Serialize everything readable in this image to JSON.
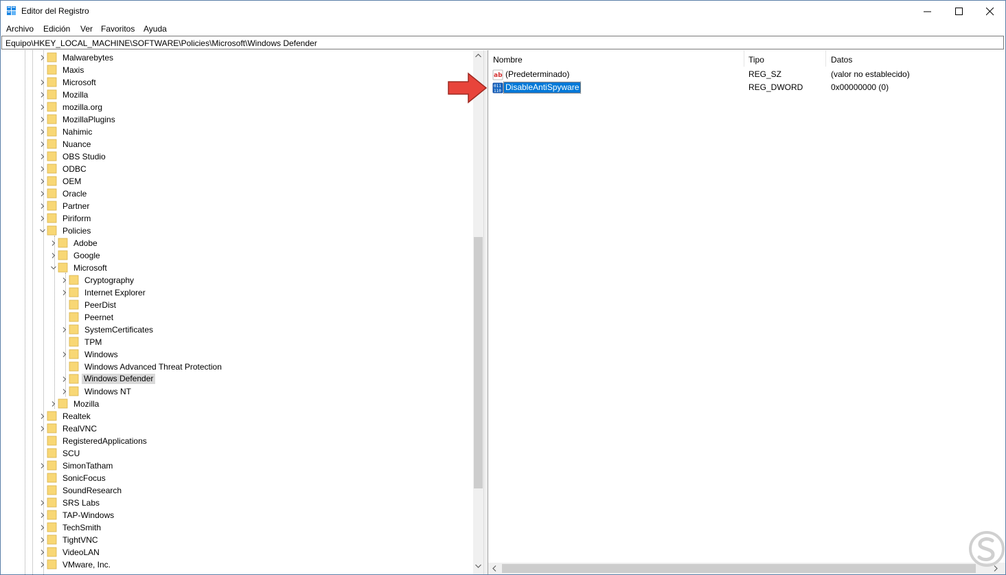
{
  "window": {
    "title": "Editor del Registro",
    "menu": [
      "Archivo",
      "Edición",
      "Ver",
      "Favoritos",
      "Ayuda"
    ],
    "address": "Equipo\\HKEY_LOCAL_MACHINE\\SOFTWARE\\Policies\\Microsoft\\Windows Defender"
  },
  "tree": {
    "items": [
      {
        "label": "Malwarebytes",
        "level": 0,
        "expander": "collapsed"
      },
      {
        "label": "Maxis",
        "level": 0,
        "expander": "none"
      },
      {
        "label": "Microsoft",
        "level": 0,
        "expander": "collapsed"
      },
      {
        "label": "Mozilla",
        "level": 0,
        "expander": "collapsed"
      },
      {
        "label": "mozilla.org",
        "level": 0,
        "expander": "collapsed"
      },
      {
        "label": "MozillaPlugins",
        "level": 0,
        "expander": "collapsed"
      },
      {
        "label": "Nahimic",
        "level": 0,
        "expander": "collapsed"
      },
      {
        "label": "Nuance",
        "level": 0,
        "expander": "collapsed"
      },
      {
        "label": "OBS Studio",
        "level": 0,
        "expander": "collapsed"
      },
      {
        "label": "ODBC",
        "level": 0,
        "expander": "collapsed"
      },
      {
        "label": "OEM",
        "level": 0,
        "expander": "collapsed"
      },
      {
        "label": "Oracle",
        "level": 0,
        "expander": "collapsed"
      },
      {
        "label": "Partner",
        "level": 0,
        "expander": "collapsed"
      },
      {
        "label": "Piriform",
        "level": 0,
        "expander": "collapsed"
      },
      {
        "label": "Policies",
        "level": 0,
        "expander": "expanded"
      },
      {
        "label": "Adobe",
        "level": 1,
        "expander": "collapsed"
      },
      {
        "label": "Google",
        "level": 1,
        "expander": "collapsed"
      },
      {
        "label": "Microsoft",
        "level": 1,
        "expander": "expanded"
      },
      {
        "label": "Cryptography",
        "level": 2,
        "expander": "collapsed"
      },
      {
        "label": "Internet Explorer",
        "level": 2,
        "expander": "collapsed"
      },
      {
        "label": "PeerDist",
        "level": 2,
        "expander": "none"
      },
      {
        "label": "Peernet",
        "level": 2,
        "expander": "none"
      },
      {
        "label": "SystemCertificates",
        "level": 2,
        "expander": "collapsed"
      },
      {
        "label": "TPM",
        "level": 2,
        "expander": "none"
      },
      {
        "label": "Windows",
        "level": 2,
        "expander": "collapsed"
      },
      {
        "label": "Windows Advanced Threat Protection",
        "level": 2,
        "expander": "none"
      },
      {
        "label": "Windows Defender",
        "level": 2,
        "expander": "collapsed",
        "selected": true
      },
      {
        "label": "Windows NT",
        "level": 2,
        "expander": "collapsed"
      },
      {
        "label": "Mozilla",
        "level": 1,
        "expander": "collapsed"
      },
      {
        "label": "Realtek",
        "level": 0,
        "expander": "collapsed"
      },
      {
        "label": "RealVNC",
        "level": 0,
        "expander": "collapsed"
      },
      {
        "label": "RegisteredApplications",
        "level": 0,
        "expander": "none"
      },
      {
        "label": "SCU",
        "level": 0,
        "expander": "none"
      },
      {
        "label": "SimonTatham",
        "level": 0,
        "expander": "collapsed"
      },
      {
        "label": "SonicFocus",
        "level": 0,
        "expander": "none"
      },
      {
        "label": "SoundResearch",
        "level": 0,
        "expander": "none"
      },
      {
        "label": "SRS Labs",
        "level": 0,
        "expander": "collapsed"
      },
      {
        "label": "TAP-Windows",
        "level": 0,
        "expander": "collapsed"
      },
      {
        "label": "TechSmith",
        "level": 0,
        "expander": "collapsed"
      },
      {
        "label": "TightVNC",
        "level": 0,
        "expander": "collapsed"
      },
      {
        "label": "VideoLAN",
        "level": 0,
        "expander": "collapsed"
      },
      {
        "label": "VMware, Inc.",
        "level": 0,
        "expander": "collapsed"
      }
    ]
  },
  "values": {
    "columns": {
      "name": "Nombre",
      "type": "Tipo",
      "data": "Datos"
    },
    "rows": [
      {
        "name": "(Predeterminado)",
        "type": "REG_SZ",
        "data": "(valor no establecido)",
        "icon": "string-value-icon",
        "selected": false
      },
      {
        "name": "DisableAntiSpyware",
        "type": "REG_DWORD",
        "data": "0x00000000 (0)",
        "icon": "binary-value-icon",
        "selected": true
      }
    ]
  },
  "colors": {
    "selection": "#0078d7",
    "tree_selection": "#d9d9d9",
    "folder": "#f8d775",
    "arrow": "#e8443b"
  }
}
